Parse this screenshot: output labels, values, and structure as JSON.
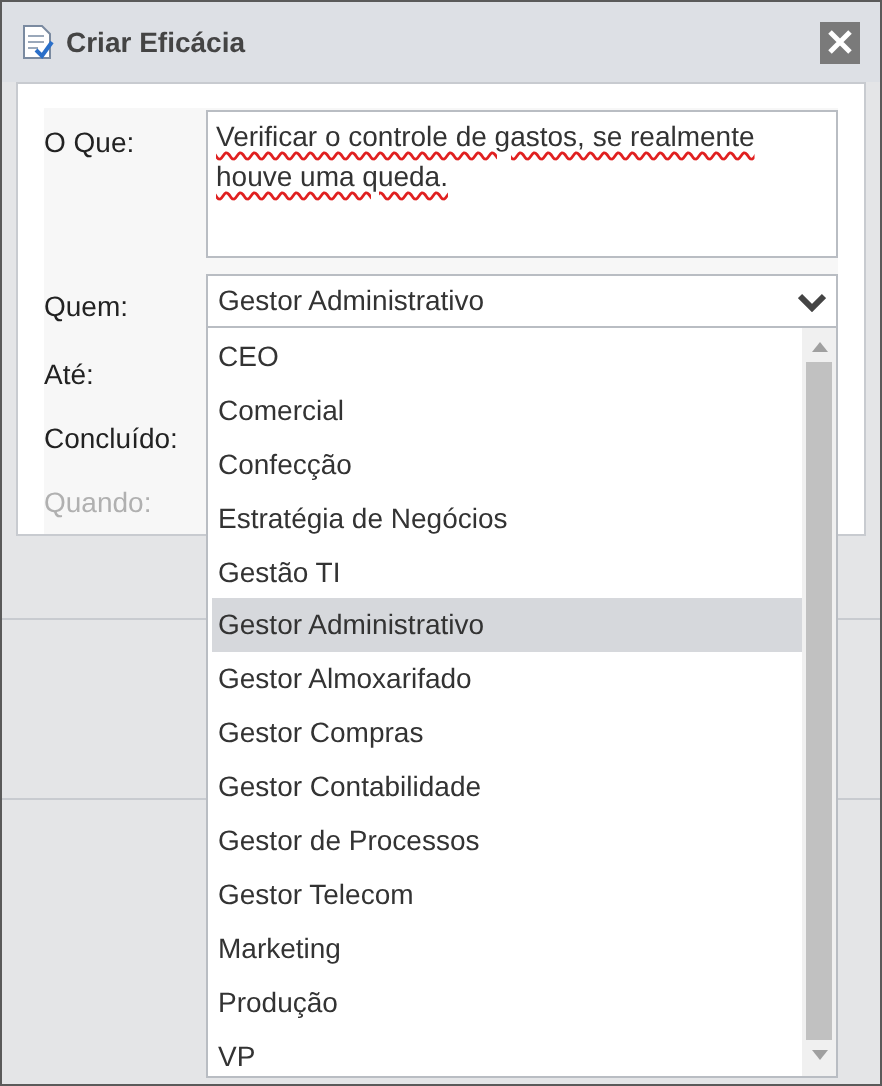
{
  "window": {
    "title": "Criar Eficácia"
  },
  "form": {
    "fields": [
      {
        "kind": "textarea",
        "label": "O Que:",
        "value": "Verificar o controle de gastos, se realmente houve uma queda.",
        "spell_error": true,
        "disabled": false
      },
      {
        "kind": "select",
        "label": "Quem:",
        "value": "Gestor Administrativo",
        "disabled": false
      },
      {
        "kind": "hidden",
        "label": "Até:",
        "disabled": false
      },
      {
        "kind": "hidden",
        "label": "Concluído:",
        "disabled": false
      },
      {
        "kind": "hidden",
        "label": "Quando:",
        "disabled": true
      }
    ]
  },
  "dropdown": {
    "options": [
      {
        "label": "CEO",
        "selected": false
      },
      {
        "label": "Comercial",
        "selected": false
      },
      {
        "label": "Confecção",
        "selected": false
      },
      {
        "label": "Estratégia de Negócios",
        "selected": false
      },
      {
        "label": "Gestão TI",
        "selected": false
      },
      {
        "label": "Gestor Administrativo",
        "selected": true
      },
      {
        "label": "Gestor Almoxarifado",
        "selected": false
      },
      {
        "label": "Gestor Compras",
        "selected": false
      },
      {
        "label": "Gestor Contabilidade",
        "selected": false
      },
      {
        "label": "Gestor de Processos",
        "selected": false
      },
      {
        "label": "Gestor Telecom",
        "selected": false
      },
      {
        "label": "Marketing",
        "selected": false
      },
      {
        "label": "Produção",
        "selected": false
      },
      {
        "label": "VP",
        "selected": false
      }
    ]
  }
}
